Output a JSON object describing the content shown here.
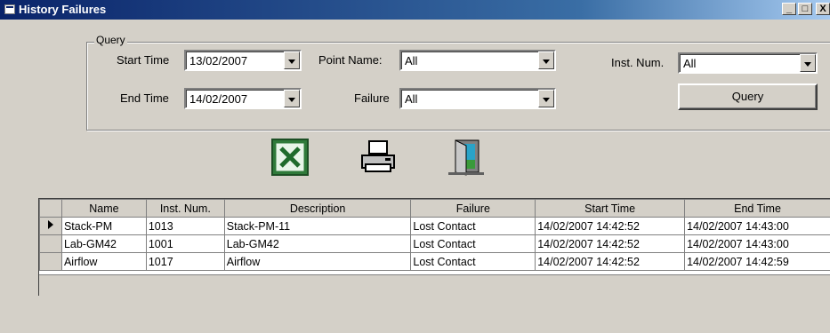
{
  "window": {
    "title": "History Failures",
    "controls": [
      "_",
      "□",
      "X"
    ]
  },
  "query": {
    "group_label": "Query",
    "start_time_label": "Start Time",
    "start_time_value": "13/02/2007",
    "end_time_label": "End Time",
    "end_time_value": "14/02/2007",
    "point_name_label": "Point Name:",
    "point_name_value": "All",
    "failure_label": "Failure",
    "failure_value": "All",
    "inst_num_label": "Inst. Num.",
    "inst_num_value": "All",
    "query_button": "Query"
  },
  "toolbar": {
    "icons": [
      "excel-export-icon",
      "printer-icon",
      "exit-door-icon"
    ]
  },
  "table": {
    "headers": [
      "Name",
      "Inst. Num.",
      "Description",
      "Failure",
      "Start Time",
      "End Time"
    ],
    "rows": [
      [
        "Stack-PM",
        "1013",
        "Stack-PM-11",
        "Lost Contact",
        "14/02/2007 14:42:52",
        "14/02/2007 14:43:00"
      ],
      [
        "Lab-GM42",
        "1001",
        "Lab-GM42",
        "Lost Contact",
        "14/02/2007 14:42:52",
        "14/02/2007 14:43:00"
      ],
      [
        "Airflow",
        "1017",
        "Airflow",
        "Lost Contact",
        "14/02/2007 14:42:52",
        "14/02/2007 14:42:59"
      ]
    ],
    "selected_row": 0
  }
}
